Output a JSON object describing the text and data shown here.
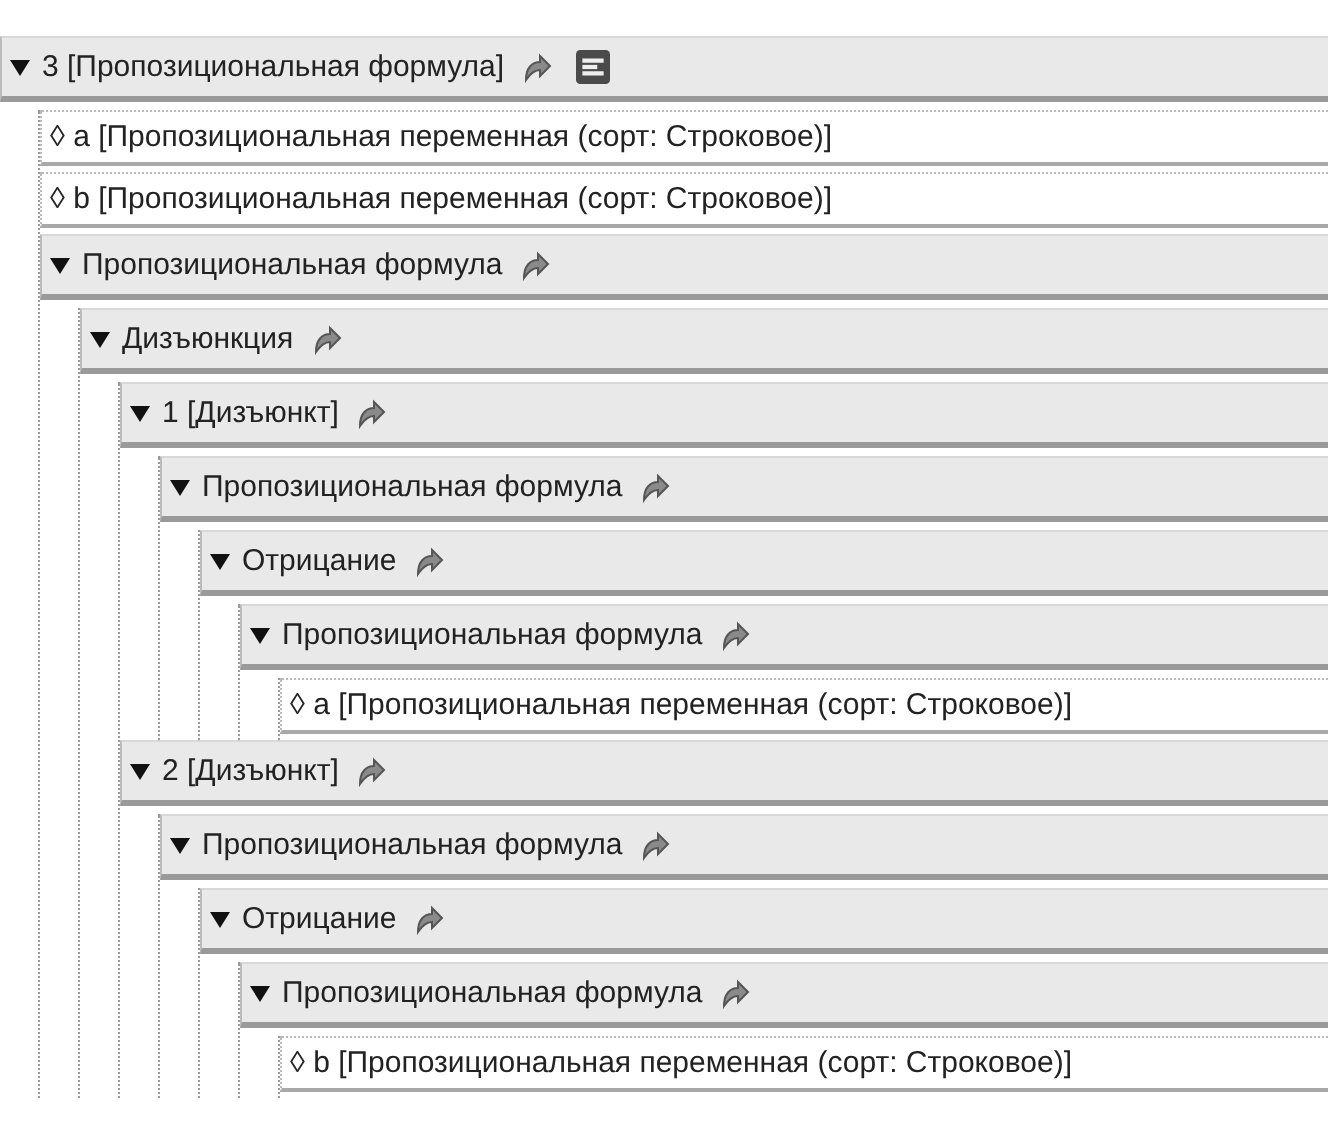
{
  "tree": {
    "kind": "node",
    "label": "3 [Пропозициональная формула]",
    "expanded": true,
    "has_menu": true,
    "children": [
      {
        "kind": "leaf",
        "label": "◊ a [Пропозициональная переменная (сорт: Строковое)]"
      },
      {
        "kind": "leaf",
        "label": "◊ b [Пропозициональная переменная (сорт: Строковое)]"
      },
      {
        "kind": "node",
        "label": "Пропозициональная формула",
        "expanded": true,
        "children": [
          {
            "kind": "node",
            "label": "Дизъюнкция",
            "expanded": true,
            "children": [
              {
                "kind": "node",
                "label": "1 [Дизъюнкт]",
                "expanded": true,
                "children": [
                  {
                    "kind": "node",
                    "label": "Пропозициональная формула",
                    "expanded": true,
                    "children": [
                      {
                        "kind": "node",
                        "label": "Отрицание",
                        "expanded": true,
                        "children": [
                          {
                            "kind": "node",
                            "label": "Пропозициональная формула",
                            "expanded": true,
                            "children": [
                              {
                                "kind": "leaf",
                                "label": "◊ a [Пропозициональная переменная (сорт: Строковое)]"
                              }
                            ]
                          }
                        ]
                      }
                    ]
                  }
                ]
              },
              {
                "kind": "node",
                "label": "2 [Дизъюнкт]",
                "expanded": true,
                "children": [
                  {
                    "kind": "node",
                    "label": "Пропозициональная формула",
                    "expanded": true,
                    "children": [
                      {
                        "kind": "node",
                        "label": "Отрицание",
                        "expanded": true,
                        "children": [
                          {
                            "kind": "node",
                            "label": "Пропозициональная формула",
                            "expanded": true,
                            "children": [
                              {
                                "kind": "leaf",
                                "label": "◊ b [Пропозициональная переменная (сорт: Строковое)]"
                              }
                            ]
                          }
                        ]
                      }
                    ]
                  }
                ]
              }
            ]
          }
        ]
      }
    ]
  }
}
